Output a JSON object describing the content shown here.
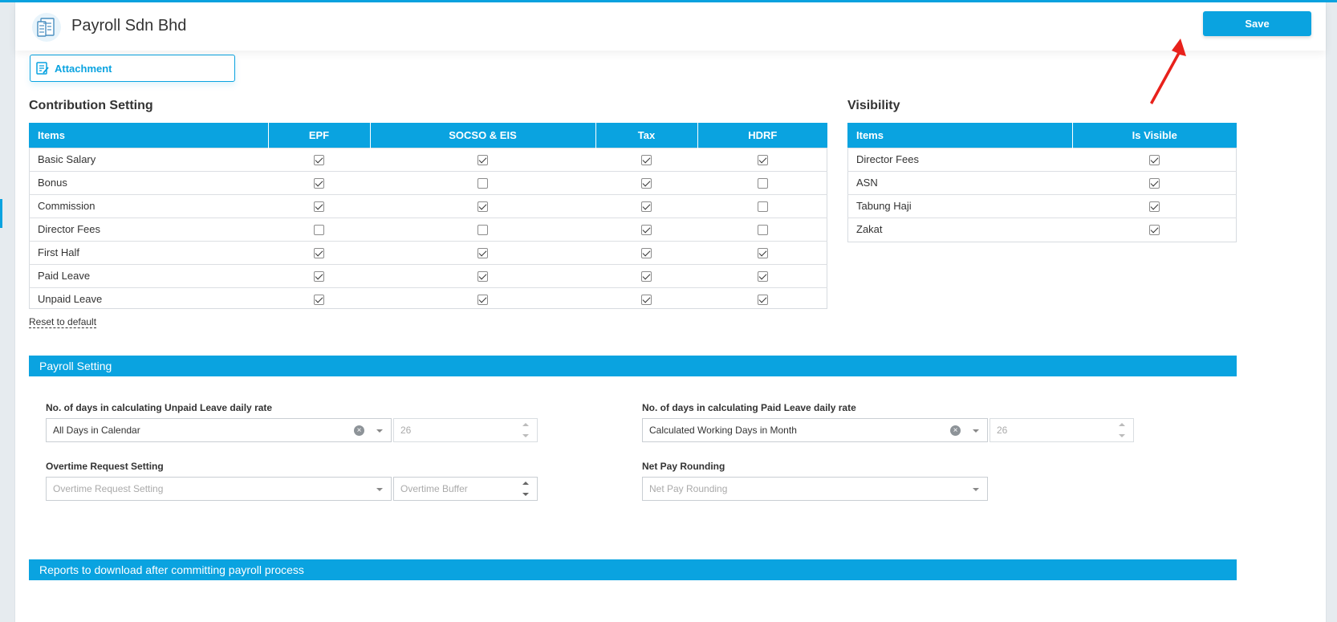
{
  "header": {
    "app_title": "Payroll Sdn Bhd",
    "save_label": "Save"
  },
  "attachment": {
    "label": "Attachment"
  },
  "contribution": {
    "title": "Contribution Setting",
    "columns": [
      "Items",
      "EPF",
      "SOCSO & EIS",
      "Tax",
      "HDRF"
    ],
    "rows": [
      {
        "label": "Basic Salary",
        "checks": [
          true,
          true,
          true,
          true
        ]
      },
      {
        "label": "Bonus",
        "checks": [
          true,
          false,
          true,
          false
        ]
      },
      {
        "label": "Commission",
        "checks": [
          true,
          true,
          true,
          false
        ]
      },
      {
        "label": "Director Fees",
        "checks": [
          false,
          false,
          true,
          false
        ]
      },
      {
        "label": "First Half",
        "checks": [
          true,
          true,
          true,
          true
        ]
      },
      {
        "label": "Paid Leave",
        "checks": [
          true,
          true,
          true,
          true
        ]
      },
      {
        "label": "Unpaid Leave",
        "checks": [
          true,
          true,
          true,
          true
        ]
      }
    ],
    "reset_label": "Reset to default"
  },
  "visibility": {
    "title": "Visibility",
    "columns": [
      "Items",
      "Is Visible"
    ],
    "rows": [
      {
        "label": "Director Fees",
        "visible": true
      },
      {
        "label": "ASN",
        "visible": true
      },
      {
        "label": "Tabung Haji",
        "visible": true
      },
      {
        "label": "Zakat",
        "visible": true
      }
    ]
  },
  "payroll_setting": {
    "title": "Payroll Setting",
    "unpaid_leave": {
      "label": "No. of days in calculating Unpaid Leave daily rate",
      "value": "All Days in Calendar",
      "days": "26"
    },
    "paid_leave": {
      "label": "No. of days in calculating Paid Leave daily rate",
      "value": "Calculated Working Days in Month",
      "days": "26"
    },
    "overtime": {
      "label": "Overtime Request Setting",
      "placeholder": "Overtime Request Setting",
      "buffer_placeholder": "Overtime Buffer"
    },
    "net_pay": {
      "label": "Net Pay Rounding",
      "placeholder": "Net Pay Rounding"
    }
  },
  "reports": {
    "title": "Reports to download after committing payroll process"
  },
  "icons": {
    "logo": "payroll-document-icon",
    "attachment": "attachment-edit-icon",
    "clear": "clear-icon",
    "dropdown": "chevron-down-icon",
    "spinner": "spinner-arrows-icon",
    "annotation": "red-pointer-arrow"
  },
  "colors": {
    "accent": "#0aa3e0",
    "annotation": "#e8211b"
  }
}
